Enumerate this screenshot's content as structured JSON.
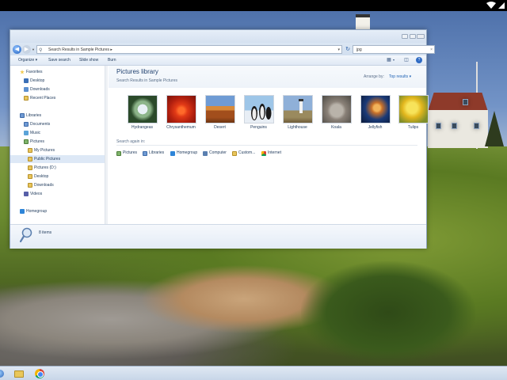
{
  "window": {
    "address": "Search Results in Sample Pictures",
    "search_value": "jpg"
  },
  "toolbar": {
    "organize": "Organize ▾",
    "save_search": "Save search",
    "slide_show": "Slide show",
    "burn": "Burn"
  },
  "navpane": {
    "favorites": "Favorites",
    "desktop": "Desktop",
    "downloads": "Downloads",
    "recent_places": "Recent Places",
    "libraries": "Libraries",
    "documents": "Documents",
    "music": "Music",
    "pictures": "Pictures",
    "my_pictures": "My Pictures",
    "public_pictures": "Public Pictures",
    "pictures_d": "Pictures (D:)",
    "pictures_desktop": "Desktop",
    "pictures_downloads": "Downloads",
    "videos": "Videos",
    "homegroup": "Homegroup"
  },
  "content": {
    "title": "Pictures library",
    "subtitle": "Search Results in Sample Pictures",
    "arrange_label": "Arrange by:",
    "arrange_value": "Top results ▾",
    "thumbnails": [
      {
        "name": "Hydrangeas"
      },
      {
        "name": "Chrysanthemum"
      },
      {
        "name": "Desert"
      },
      {
        "name": "Penguins"
      },
      {
        "name": "Lighthouse"
      },
      {
        "name": "Koala"
      },
      {
        "name": "Jellyfish"
      },
      {
        "name": "Tulips"
      }
    ],
    "search_again_label": "Search again in:",
    "search_again": [
      {
        "label": "Pictures"
      },
      {
        "label": "Libraries"
      },
      {
        "label": "Homegroup"
      },
      {
        "label": "Computer"
      },
      {
        "label": "Custom..."
      },
      {
        "label": "Internet"
      }
    ]
  },
  "details": {
    "count": "8 items"
  },
  "colors": {
    "accent": "#1f63b5",
    "title_blue": "#1e3f6e"
  }
}
